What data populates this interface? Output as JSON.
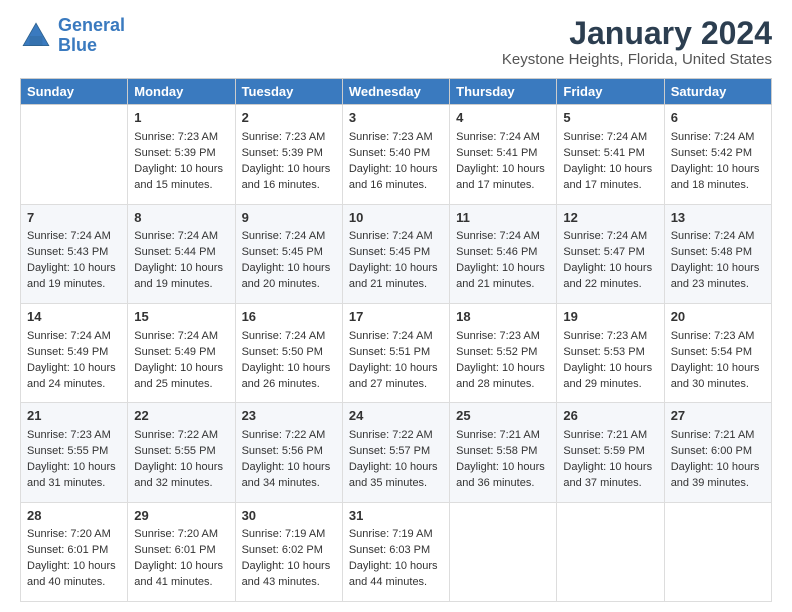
{
  "logo": {
    "line1": "General",
    "line2": "Blue"
  },
  "title": "January 2024",
  "subtitle": "Keystone Heights, Florida, United States",
  "days": [
    "Sunday",
    "Monday",
    "Tuesday",
    "Wednesday",
    "Thursday",
    "Friday",
    "Saturday"
  ],
  "weeks": [
    [
      {
        "date": "",
        "sunrise": "",
        "sunset": "",
        "daylight": ""
      },
      {
        "date": "1",
        "sunrise": "Sunrise: 7:23 AM",
        "sunset": "Sunset: 5:39 PM",
        "daylight": "Daylight: 10 hours and 15 minutes."
      },
      {
        "date": "2",
        "sunrise": "Sunrise: 7:23 AM",
        "sunset": "Sunset: 5:39 PM",
        "daylight": "Daylight: 10 hours and 16 minutes."
      },
      {
        "date": "3",
        "sunrise": "Sunrise: 7:23 AM",
        "sunset": "Sunset: 5:40 PM",
        "daylight": "Daylight: 10 hours and 16 minutes."
      },
      {
        "date": "4",
        "sunrise": "Sunrise: 7:24 AM",
        "sunset": "Sunset: 5:41 PM",
        "daylight": "Daylight: 10 hours and 17 minutes."
      },
      {
        "date": "5",
        "sunrise": "Sunrise: 7:24 AM",
        "sunset": "Sunset: 5:41 PM",
        "daylight": "Daylight: 10 hours and 17 minutes."
      },
      {
        "date": "6",
        "sunrise": "Sunrise: 7:24 AM",
        "sunset": "Sunset: 5:42 PM",
        "daylight": "Daylight: 10 hours and 18 minutes."
      }
    ],
    [
      {
        "date": "7",
        "sunrise": "Sunrise: 7:24 AM",
        "sunset": "Sunset: 5:43 PM",
        "daylight": "Daylight: 10 hours and 19 minutes."
      },
      {
        "date": "8",
        "sunrise": "Sunrise: 7:24 AM",
        "sunset": "Sunset: 5:44 PM",
        "daylight": "Daylight: 10 hours and 19 minutes."
      },
      {
        "date": "9",
        "sunrise": "Sunrise: 7:24 AM",
        "sunset": "Sunset: 5:45 PM",
        "daylight": "Daylight: 10 hours and 20 minutes."
      },
      {
        "date": "10",
        "sunrise": "Sunrise: 7:24 AM",
        "sunset": "Sunset: 5:45 PM",
        "daylight": "Daylight: 10 hours and 21 minutes."
      },
      {
        "date": "11",
        "sunrise": "Sunrise: 7:24 AM",
        "sunset": "Sunset: 5:46 PM",
        "daylight": "Daylight: 10 hours and 21 minutes."
      },
      {
        "date": "12",
        "sunrise": "Sunrise: 7:24 AM",
        "sunset": "Sunset: 5:47 PM",
        "daylight": "Daylight: 10 hours and 22 minutes."
      },
      {
        "date": "13",
        "sunrise": "Sunrise: 7:24 AM",
        "sunset": "Sunset: 5:48 PM",
        "daylight": "Daylight: 10 hours and 23 minutes."
      }
    ],
    [
      {
        "date": "14",
        "sunrise": "Sunrise: 7:24 AM",
        "sunset": "Sunset: 5:49 PM",
        "daylight": "Daylight: 10 hours and 24 minutes."
      },
      {
        "date": "15",
        "sunrise": "Sunrise: 7:24 AM",
        "sunset": "Sunset: 5:49 PM",
        "daylight": "Daylight: 10 hours and 25 minutes."
      },
      {
        "date": "16",
        "sunrise": "Sunrise: 7:24 AM",
        "sunset": "Sunset: 5:50 PM",
        "daylight": "Daylight: 10 hours and 26 minutes."
      },
      {
        "date": "17",
        "sunrise": "Sunrise: 7:24 AM",
        "sunset": "Sunset: 5:51 PM",
        "daylight": "Daylight: 10 hours and 27 minutes."
      },
      {
        "date": "18",
        "sunrise": "Sunrise: 7:23 AM",
        "sunset": "Sunset: 5:52 PM",
        "daylight": "Daylight: 10 hours and 28 minutes."
      },
      {
        "date": "19",
        "sunrise": "Sunrise: 7:23 AM",
        "sunset": "Sunset: 5:53 PM",
        "daylight": "Daylight: 10 hours and 29 minutes."
      },
      {
        "date": "20",
        "sunrise": "Sunrise: 7:23 AM",
        "sunset": "Sunset: 5:54 PM",
        "daylight": "Daylight: 10 hours and 30 minutes."
      }
    ],
    [
      {
        "date": "21",
        "sunrise": "Sunrise: 7:23 AM",
        "sunset": "Sunset: 5:55 PM",
        "daylight": "Daylight: 10 hours and 31 minutes."
      },
      {
        "date": "22",
        "sunrise": "Sunrise: 7:22 AM",
        "sunset": "Sunset: 5:55 PM",
        "daylight": "Daylight: 10 hours and 32 minutes."
      },
      {
        "date": "23",
        "sunrise": "Sunrise: 7:22 AM",
        "sunset": "Sunset: 5:56 PM",
        "daylight": "Daylight: 10 hours and 34 minutes."
      },
      {
        "date": "24",
        "sunrise": "Sunrise: 7:22 AM",
        "sunset": "Sunset: 5:57 PM",
        "daylight": "Daylight: 10 hours and 35 minutes."
      },
      {
        "date": "25",
        "sunrise": "Sunrise: 7:21 AM",
        "sunset": "Sunset: 5:58 PM",
        "daylight": "Daylight: 10 hours and 36 minutes."
      },
      {
        "date": "26",
        "sunrise": "Sunrise: 7:21 AM",
        "sunset": "Sunset: 5:59 PM",
        "daylight": "Daylight: 10 hours and 37 minutes."
      },
      {
        "date": "27",
        "sunrise": "Sunrise: 7:21 AM",
        "sunset": "Sunset: 6:00 PM",
        "daylight": "Daylight: 10 hours and 39 minutes."
      }
    ],
    [
      {
        "date": "28",
        "sunrise": "Sunrise: 7:20 AM",
        "sunset": "Sunset: 6:01 PM",
        "daylight": "Daylight: 10 hours and 40 minutes."
      },
      {
        "date": "29",
        "sunrise": "Sunrise: 7:20 AM",
        "sunset": "Sunset: 6:01 PM",
        "daylight": "Daylight: 10 hours and 41 minutes."
      },
      {
        "date": "30",
        "sunrise": "Sunrise: 7:19 AM",
        "sunset": "Sunset: 6:02 PM",
        "daylight": "Daylight: 10 hours and 43 minutes."
      },
      {
        "date": "31",
        "sunrise": "Sunrise: 7:19 AM",
        "sunset": "Sunset: 6:03 PM",
        "daylight": "Daylight: 10 hours and 44 minutes."
      },
      {
        "date": "",
        "sunrise": "",
        "sunset": "",
        "daylight": ""
      },
      {
        "date": "",
        "sunrise": "",
        "sunset": "",
        "daylight": ""
      },
      {
        "date": "",
        "sunrise": "",
        "sunset": "",
        "daylight": ""
      }
    ]
  ]
}
